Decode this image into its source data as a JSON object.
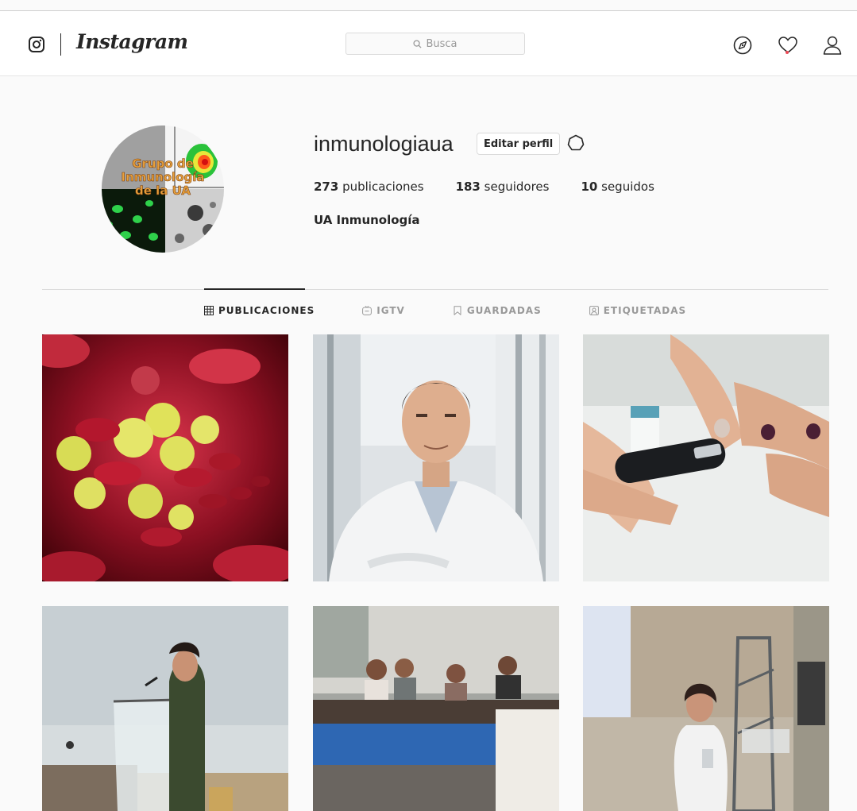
{
  "nav": {
    "brand": "Instagram",
    "search_placeholder": "Busca"
  },
  "profile": {
    "avatar_text": [
      "Grupo de",
      "Inmunología",
      "de la UA"
    ],
    "username": "inmunologiaua",
    "edit_label": "Editar perfil",
    "stats": [
      {
        "count": "273",
        "label": "publicaciones"
      },
      {
        "count": "183",
        "label": "seguidores"
      },
      {
        "count": "10",
        "label": "seguidos"
      }
    ],
    "full_name": "UA Inmunología"
  },
  "tabs": [
    {
      "label": "PUBLICACIONES",
      "icon": "grid-icon"
    },
    {
      "label": "IGTV",
      "icon": "igtv-icon"
    },
    {
      "label": "GUARDADAS",
      "icon": "bookmark-icon"
    },
    {
      "label": "ETIQUETADAS",
      "icon": "tag-icon"
    }
  ],
  "posts": [
    {
      "subject": "blood-cells"
    },
    {
      "subject": "doctor-portrait"
    },
    {
      "subject": "glucose-meter"
    },
    {
      "subject": "speaker-podium"
    },
    {
      "subject": "conference-panel"
    },
    {
      "subject": "speaker-presentation"
    }
  ],
  "colors": {
    "accent": "#262626",
    "notification": "#ed4956",
    "border": "#dbdbdb",
    "muted": "#999999"
  }
}
